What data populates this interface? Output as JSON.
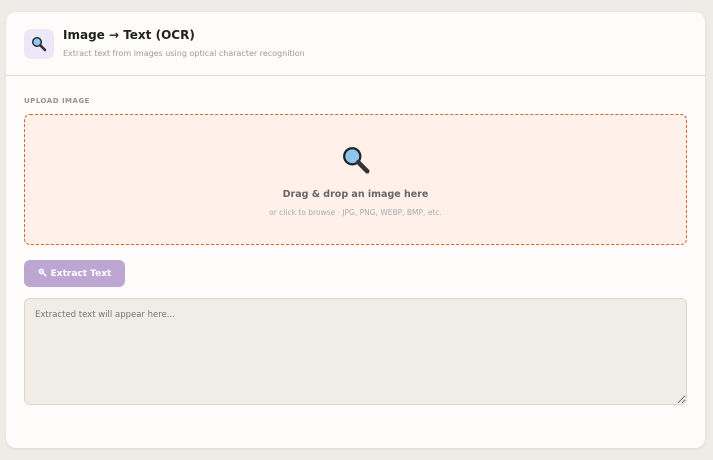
{
  "header": {
    "title": "Image → Text (OCR)",
    "subtitle": "Extract text from images using optical character recognition",
    "icon": "magnifier-icon"
  },
  "upload": {
    "label": "UPLOAD IMAGE",
    "title": "Drag & drop an image here",
    "hint": "or click to browse · JPG, PNG, WEBP, BMP, etc."
  },
  "button": {
    "label": "Extract Text"
  },
  "output": {
    "placeholder": "Extracted text will appear here...",
    "value": ""
  },
  "colors": {
    "accent": "#bda7d2",
    "drop_border": "#d9632a",
    "drop_bg": "#fff0ea"
  }
}
